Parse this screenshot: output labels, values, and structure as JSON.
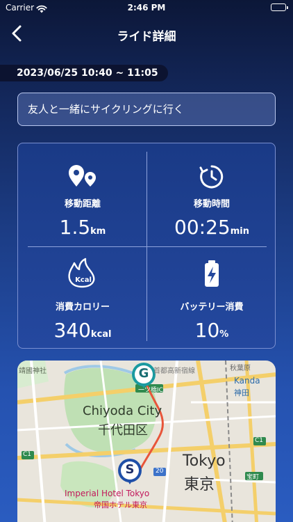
{
  "status_bar": {
    "carrier": "Carrier",
    "time": "2:46 PM"
  },
  "nav": {
    "title": "ライド詳細"
  },
  "ride": {
    "date_range": "2023/06/25 10:40 ~ 11:05",
    "memo": "友人と一緒にサイクリングに行く"
  },
  "stats": {
    "distance": {
      "label": "移動距離",
      "value": "1.5",
      "unit": "km",
      "icon": "map-pins-icon"
    },
    "duration": {
      "label": "移動時間",
      "value": "00:25",
      "unit": "min",
      "icon": "clock-icon"
    },
    "calories": {
      "label": "消費カロリー",
      "value": "340",
      "unit": "kcal",
      "icon": "flame-kcal-icon",
      "icon_text": "Kcal"
    },
    "battery": {
      "label": "バッテリー消費",
      "value": "10",
      "unit": "%",
      "icon": "battery-charge-icon"
    }
  },
  "map": {
    "labels": {
      "chiyoda_en": "Chiyoda City",
      "chiyoda_jp": "千代田区",
      "tokyo_en": "Tokyo",
      "tokyo_jp": "東京",
      "kanda_en": "Kanda",
      "kanda_jp": "神田",
      "hotel_en": "Imperial Hotel Tokyo",
      "hotel_jp": "帝国ホテル東京",
      "shrine": "靖國神社",
      "shinjuku": "首都高新宿線",
      "akihabara": "秋葉原",
      "ic": "一ツ橋IC",
      "takara": "宝町",
      "c1": "C1",
      "route20": "20"
    },
    "markers": {
      "goal": "G",
      "start": "S"
    },
    "colors": {
      "route": "#e8553a",
      "goal": "#1b9aa0",
      "start": "#1f4fa8"
    }
  }
}
